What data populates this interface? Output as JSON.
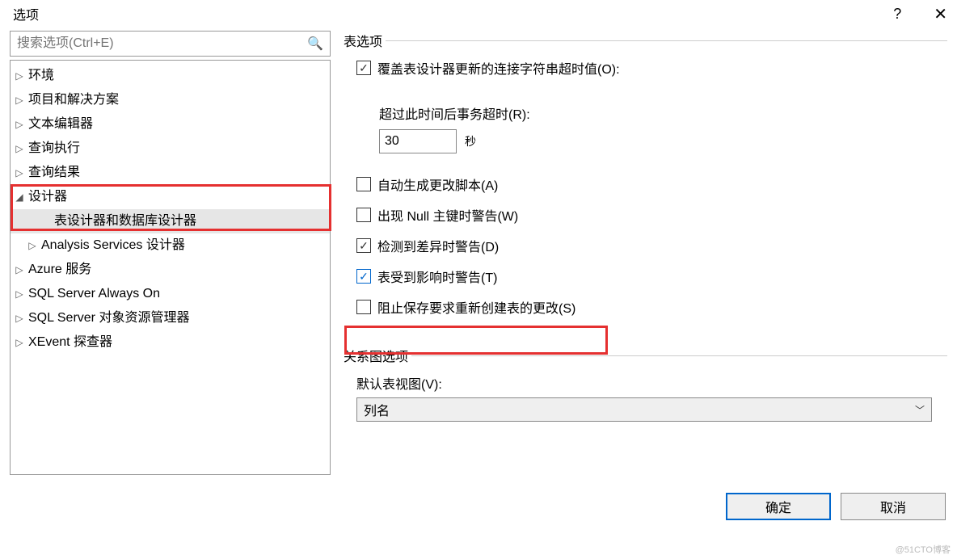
{
  "title": "选项",
  "help_symbol": "?",
  "close_symbol": "✕",
  "search": {
    "placeholder": "搜索选项(Ctrl+E)"
  },
  "tree": {
    "items": [
      {
        "glyph": "▷",
        "label": "环境",
        "indent": 0
      },
      {
        "glyph": "▷",
        "label": "项目和解决方案",
        "indent": 0
      },
      {
        "glyph": "▷",
        "label": "文本编辑器",
        "indent": 0
      },
      {
        "glyph": "▷",
        "label": "查询执行",
        "indent": 0
      },
      {
        "glyph": "▷",
        "label": "查询结果",
        "indent": 0
      },
      {
        "glyph": "◢",
        "label": "设计器",
        "indent": 0
      },
      {
        "glyph": "",
        "label": "表设计器和数据库设计器",
        "indent": 2,
        "selected": true
      },
      {
        "glyph": "▷",
        "label": "Analysis Services 设计器",
        "indent": 1
      },
      {
        "glyph": "▷",
        "label": "Azure 服务",
        "indent": 0
      },
      {
        "glyph": "▷",
        "label": "SQL Server Always On",
        "indent": 0
      },
      {
        "glyph": "▷",
        "label": "SQL Server 对象资源管理器",
        "indent": 0
      },
      {
        "glyph": "▷",
        "label": "XEvent 探查器",
        "indent": 0
      }
    ]
  },
  "table_options": {
    "group_title": "表选项",
    "override_label": "覆盖表设计器更新的连接字符串超时值(O):",
    "timeout_label": "超过此时间后事务超时(R):",
    "timeout_value": "30",
    "timeout_unit": "秒",
    "auto_script_label": "自动生成更改脚本(A)",
    "null_pk_label": "出现 Null 主键时警告(W)",
    "diff_warn_label": "检测到差异时警告(D)",
    "affected_warn_label": "表受到影响时警告(T)",
    "prevent_save_label": "阻止保存要求重新创建表的更改(S)"
  },
  "diagram_options": {
    "group_title": "关系图选项",
    "default_view_label": "默认表视图(V):",
    "dropdown_value": "列名"
  },
  "buttons": {
    "ok": "确定",
    "cancel": "取消"
  },
  "watermark": "@51CTO博客"
}
